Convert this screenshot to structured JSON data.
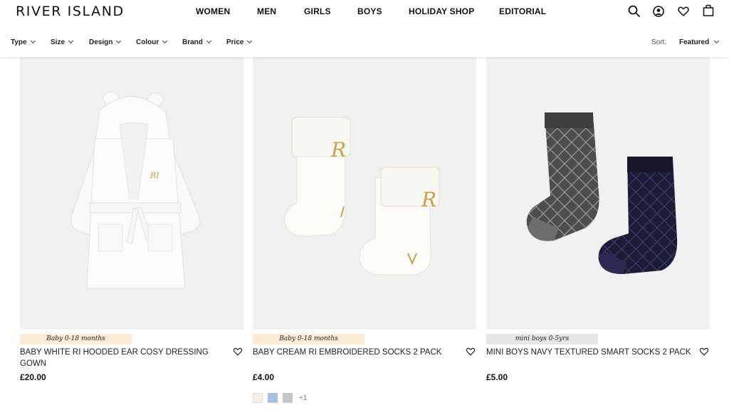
{
  "brand": {
    "logo": "RIVER ISLAND"
  },
  "nav": {
    "items": [
      "WOMEN",
      "MEN",
      "GIRLS",
      "BOYS",
      "HOLIDAY SHOP",
      "EDITORIAL"
    ]
  },
  "header_icons": [
    "search-icon",
    "account-icon",
    "wishlist-heart-icon",
    "shopping-bag-icon"
  ],
  "filters": {
    "items": [
      "Type",
      "Size",
      "Design",
      "Colour",
      "Brand",
      "Price"
    ]
  },
  "sort": {
    "label": "Sort:",
    "value": "Featured"
  },
  "colors": {
    "peach_tag": "#fdebd5",
    "grey_tag": "#e6e6e6",
    "image_bg": "#f1f1f1"
  },
  "products": [
    {
      "tag": "Baby 0-18 months",
      "title": "BABY WHITE RI HOODED EAR COSY DRESSING GOWN",
      "price": "£20.00"
    },
    {
      "tag": "Baby 0-18 months",
      "title": "BABY CREAM RI EMBROIDERED SOCKS 2 PACK",
      "price": "£4.00",
      "swatches": [
        "#f3f1e9",
        "#a8c0e6",
        "#c6c6c6"
      ],
      "more_colours": "+1"
    },
    {
      "tag": "mini boys 0-5yrs",
      "title": "MINI BOYS NAVY TEXTURED SMART SOCKS 2 PACK",
      "price": "£5.00"
    }
  ]
}
